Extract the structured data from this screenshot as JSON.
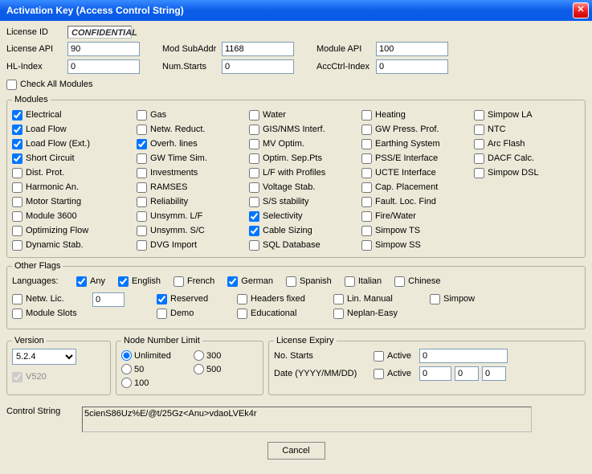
{
  "title": "Activation Key (Access Control String)",
  "header": {
    "license_id_label": "License ID",
    "license_id_value": "CONFIDENTIAL",
    "license_api_label": "License API",
    "license_api_value": "90",
    "mod_subaddr_label": "Mod SubAddr",
    "mod_subaddr_value": "1168",
    "module_api_label": "Module API",
    "module_api_value": "100",
    "hl_index_label": "HL-Index",
    "hl_index_value": "0",
    "num_starts_label": "Num.Starts",
    "num_starts_value": "0",
    "accctrl_index_label": "AccCtrl-Index",
    "accctrl_index_value": "0",
    "check_all_label": "Check All Modules"
  },
  "modules": {
    "legend": "Modules",
    "col1": [
      {
        "label": "Electrical",
        "checked": true
      },
      {
        "label": "Load Flow",
        "checked": true
      },
      {
        "label": "Load Flow (Ext.)",
        "checked": true
      },
      {
        "label": "Short Circuit",
        "checked": true
      },
      {
        "label": "Dist. Prot.",
        "checked": false
      },
      {
        "label": "Harmonic An.",
        "checked": false
      },
      {
        "label": "Motor Starting",
        "checked": false
      },
      {
        "label": "Module 3600",
        "checked": false
      },
      {
        "label": "Optimizing Flow",
        "checked": false
      },
      {
        "label": "Dynamic Stab.",
        "checked": false
      }
    ],
    "col2": [
      {
        "label": "Gas",
        "checked": false
      },
      {
        "label": "Netw. Reduct.",
        "checked": false
      },
      {
        "label": "Overh. lines",
        "checked": true
      },
      {
        "label": "GW Time Sim.",
        "checked": false
      },
      {
        "label": "Investments",
        "checked": false
      },
      {
        "label": "RAMSES",
        "checked": false
      },
      {
        "label": "Reliability",
        "checked": false
      },
      {
        "label": "Unsymm. L/F",
        "checked": false
      },
      {
        "label": "Unsymm. S/C",
        "checked": false
      },
      {
        "label": "DVG Import",
        "checked": false
      }
    ],
    "col3": [
      {
        "label": "Water",
        "checked": false
      },
      {
        "label": "GIS/NMS Interf.",
        "checked": false
      },
      {
        "label": "MV Optim.",
        "checked": false
      },
      {
        "label": "Optim. Sep.Pts",
        "checked": false
      },
      {
        "label": "L/F with Profiles",
        "checked": false
      },
      {
        "label": "Voltage Stab.",
        "checked": false
      },
      {
        "label": "S/S stability",
        "checked": false
      },
      {
        "label": "Selectivity",
        "checked": true
      },
      {
        "label": "Cable Sizing",
        "checked": true
      },
      {
        "label": "SQL Database",
        "checked": false
      }
    ],
    "col4": [
      {
        "label": "Heating",
        "checked": false
      },
      {
        "label": "GW Press. Prof.",
        "checked": false
      },
      {
        "label": "Earthing System",
        "checked": false
      },
      {
        "label": "PSS/E Interface",
        "checked": false
      },
      {
        "label": "UCTE Interface",
        "checked": false
      },
      {
        "label": "Cap. Placement",
        "checked": false
      },
      {
        "label": "Fault. Loc. Find",
        "checked": false
      },
      {
        "label": "Fire/Water",
        "checked": false
      },
      {
        "label": "Simpow TS",
        "checked": false
      },
      {
        "label": "Simpow SS",
        "checked": false
      }
    ],
    "col5": [
      {
        "label": "Simpow LA",
        "checked": false
      },
      {
        "label": "NTC",
        "checked": false
      },
      {
        "label": "Arc Flash",
        "checked": false
      },
      {
        "label": "DACF Calc.",
        "checked": false
      },
      {
        "label": "Simpow DSL",
        "checked": false
      }
    ]
  },
  "other_flags": {
    "legend": "Other Flags",
    "languages_label": "Languages:",
    "langs": [
      {
        "label": "Any",
        "checked": true
      },
      {
        "label": "English",
        "checked": true
      },
      {
        "label": "French",
        "checked": false
      },
      {
        "label": "German",
        "checked": true
      },
      {
        "label": "Spanish",
        "checked": false
      },
      {
        "label": "Italian",
        "checked": false
      },
      {
        "label": "Chinese",
        "checked": false
      }
    ],
    "row2_left": [
      {
        "label": "Netw. Lic.",
        "checked": false
      },
      {
        "label": "Module Slots",
        "checked": false
      }
    ],
    "netw_lic_value": "0",
    "row2_mid": [
      {
        "label": "Reserved",
        "checked": true
      },
      {
        "label": "Demo",
        "checked": false
      }
    ],
    "row2_right1": [
      {
        "label": "Headers fixed",
        "checked": false
      },
      {
        "label": "Educational",
        "checked": false
      }
    ],
    "row2_right2": [
      {
        "label": "Lin. Manual",
        "checked": false
      },
      {
        "label": "Neplan-Easy",
        "checked": false
      }
    ],
    "row2_right3": [
      {
        "label": "Simpow",
        "checked": false
      }
    ]
  },
  "version": {
    "legend": "Version",
    "selected": "5.2.4",
    "v520_label": "V520",
    "v520_checked": true
  },
  "node_limit": {
    "legend": "Node Number Limit",
    "options": [
      {
        "label": "Unlimited",
        "checked": true
      },
      {
        "label": "50",
        "checked": false
      },
      {
        "label": "100",
        "checked": false
      },
      {
        "label": "300",
        "checked": false
      },
      {
        "label": "500",
        "checked": false
      }
    ]
  },
  "license_expiry": {
    "legend": "License Expiry",
    "no_starts_label": "No. Starts",
    "no_starts_active_label": "Active",
    "no_starts_active": false,
    "no_starts_value": "0",
    "date_label": "Date (YYYY/MM/DD)",
    "date_active_label": "Active",
    "date_active": false,
    "date_y": "0",
    "date_m": "0",
    "date_d": "0"
  },
  "control_string": {
    "label": "Control String",
    "value": "5cienS86Uz%E/@t/25Gz<Anu>vdaoLVEk4r"
  },
  "cancel_label": "Cancel"
}
